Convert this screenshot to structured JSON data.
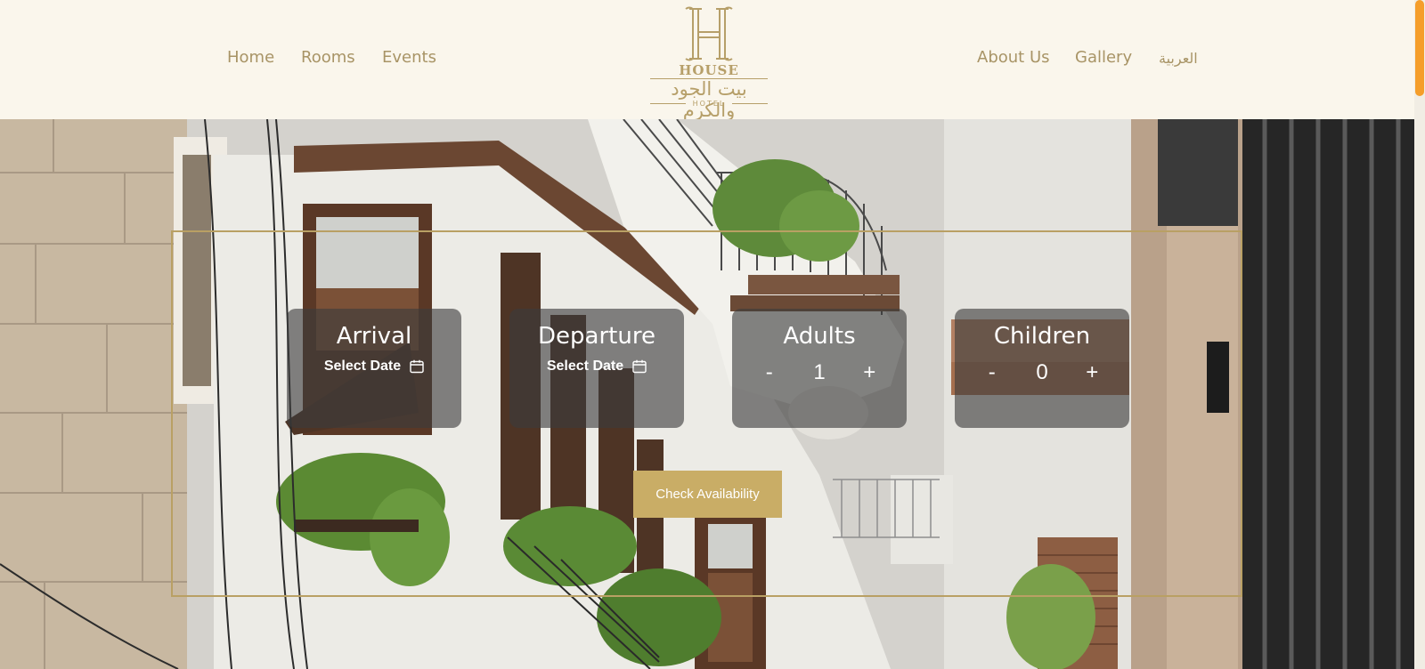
{
  "nav": {
    "home": "Home",
    "rooms": "Rooms",
    "events": "Events",
    "about": "About Us",
    "gallery": "Gallery",
    "language": "العربية"
  },
  "logo": {
    "monogram": "H",
    "wordmark": "HOUSE",
    "arabic_name": "بيت الجود والكرم",
    "subtitle": "HOTEL"
  },
  "booking": {
    "arrival": {
      "title": "Arrival",
      "value": "Select Date",
      "icon": "calendar-icon"
    },
    "departure": {
      "title": "Departure",
      "value": "Select Date",
      "icon": "calendar-icon"
    },
    "adults": {
      "title": "Adults",
      "decrement": "-",
      "count": "1",
      "increment": "+"
    },
    "children": {
      "title": "Children",
      "decrement": "-",
      "count": "0",
      "increment": "+"
    },
    "check_button": "Check Availability"
  },
  "colors": {
    "accent_gold": "#b9a064",
    "button_gold": "#c9ad66",
    "nav_text": "#a89466",
    "header_bg": "#faf6ec",
    "scroll_thumb": "#f59e2a"
  }
}
